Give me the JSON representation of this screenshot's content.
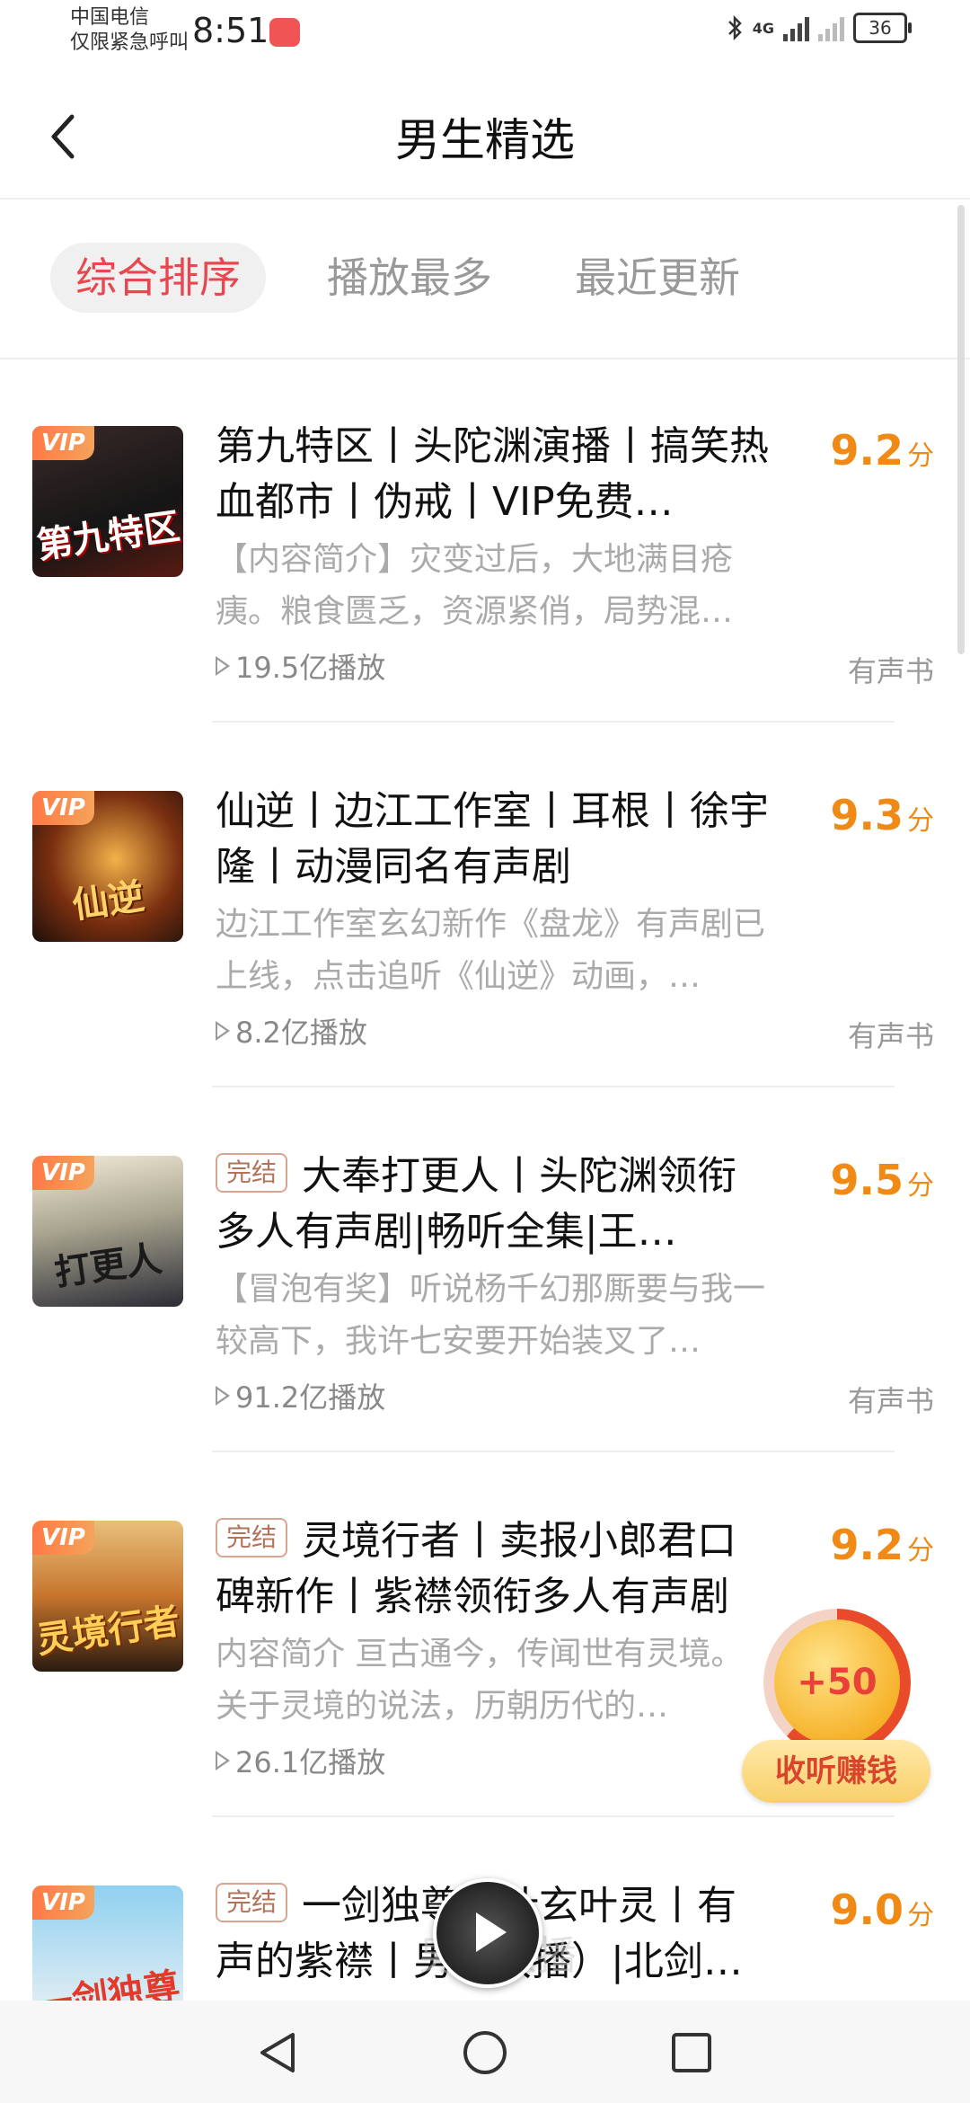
{
  "status_bar": {
    "carrier_line1": "中国电信",
    "carrier_line2": "仅限紧急呼叫",
    "time": "8:51",
    "network": "4G",
    "battery": "36"
  },
  "header": {
    "title": "男生精选"
  },
  "tabs": [
    {
      "label": "综合排序",
      "active": true
    },
    {
      "label": "播放最多",
      "active": false
    },
    {
      "label": "最近更新",
      "active": false
    }
  ],
  "items": [
    {
      "vip": "VIP",
      "cover_text": "第九特区",
      "tag": "",
      "title": "第九特区丨头陀渊演播丨搞笑热血都市丨伪戒丨VIP免费…",
      "desc": "【内容简介】灾变过后，大地满目疮痍。粮食匮乏，资源紧俏，局势混…",
      "plays": "19.5亿播放",
      "score": "9.2",
      "score_unit": "分",
      "type": "有声书"
    },
    {
      "vip": "VIP",
      "cover_text": "仙逆",
      "tag": "",
      "title": "仙逆丨边江工作室丨耳根丨徐宇隆丨动漫同名有声剧",
      "desc": "边江工作室玄幻新作《盘龙》有声剧已上线，点击追听《仙逆》动画，…",
      "plays": "8.2亿播放",
      "score": "9.3",
      "score_unit": "分",
      "type": "有声书"
    },
    {
      "vip": "VIP",
      "cover_text": "打更人",
      "tag": "完结",
      "title": "大奉打更人丨头陀渊领衔多人有声剧|畅听全集|王…",
      "desc": "【冒泡有奖】听说杨千幻那厮要与我一较高下，我许七安要开始装叉了…",
      "plays": "91.2亿播放",
      "score": "9.5",
      "score_unit": "分",
      "type": "有声书"
    },
    {
      "vip": "VIP",
      "cover_text": "灵境行者",
      "tag": "完结",
      "title": "灵境行者丨卖报小郎君口碑新作丨紫襟领衔多人有声剧",
      "desc": "内容简介 亘古通今，传闻世有灵境。关于灵境的说法，历朝历代的…",
      "plays": "26.1亿播放",
      "score": "9.2",
      "score_unit": "分",
      "type": ""
    },
    {
      "vip": "VIP",
      "cover_text": "一剑独尊",
      "tag": "完结",
      "title": "一剑独尊（叶玄叶灵丨有声的紫襟丨男女双播）|北剑…",
      "desc": "",
      "plays": "",
      "score": "9.0",
      "score_unit": "分",
      "type": ""
    }
  ],
  "reward": {
    "value": "+50",
    "label": "收听赚钱",
    "progress": 0.62
  },
  "mini_player": {
    "ghost_text": "男女双播"
  },
  "colors": {
    "accent": "#e8474f",
    "score": "#f08a14",
    "vip_gradient_start": "#ff7a45"
  }
}
